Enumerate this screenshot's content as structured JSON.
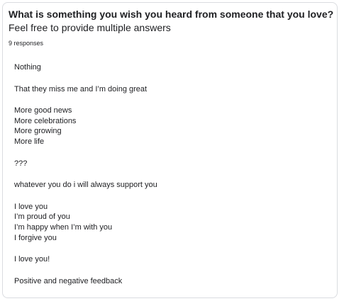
{
  "question": {
    "title": "What is something you wish you heard from someone that you love?",
    "description": "Feel free to provide multiple answers",
    "response_count": "9 responses"
  },
  "responses": [
    {
      "lines": [
        "Nothing"
      ]
    },
    {
      "lines": [
        "That they miss me and I’m doing great"
      ]
    },
    {
      "lines": [
        "More good news",
        "More celebrations",
        "More growing",
        "More life"
      ]
    },
    {
      "lines": [
        "???"
      ]
    },
    {
      "lines": [
        "whatever you do i will always support you"
      ]
    },
    {
      "lines": [
        "I love you",
        "I’m proud of you",
        "I’m happy when I’m with you",
        "I forgive you"
      ]
    },
    {
      "lines": [
        "I love you!"
      ]
    },
    {
      "lines": [
        "Positive and negative feedback"
      ]
    }
  ]
}
